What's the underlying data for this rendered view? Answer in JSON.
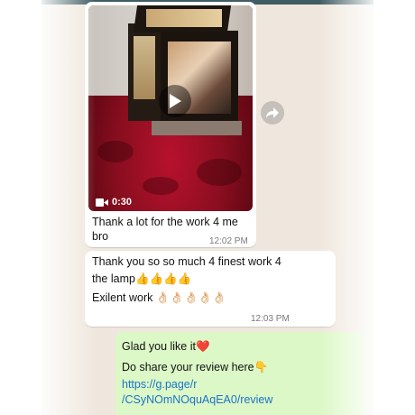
{
  "messages": [
    {
      "direction": "incoming",
      "media": {
        "type": "video",
        "duration": "0:30"
      },
      "text_lines": [
        "Thank a lot for the work 4 me",
        "bro"
      ],
      "time": "12:02 PM"
    },
    {
      "direction": "incoming",
      "text_lines": [
        "Thank you so so much 4 finest work 4",
        "the lamp👍👍👍👍",
        "Exilent work 👌🏻👌🏻👌🏻👌🏻👌🏻"
      ],
      "time": "12:03 PM"
    },
    {
      "direction": "outgoing",
      "text_lines": [
        "Glad you like it❤️",
        "Do share your review here👇"
      ],
      "link_lines": [
        "https://g.page/r",
        "/CSyNOmNOquAqEA0/review"
      ]
    }
  ],
  "icons": {
    "play": "play-icon",
    "video_camera": "video-camera-icon",
    "forward": "forward-icon"
  },
  "colors": {
    "chat_background": "#efe7dd",
    "incoming_bubble": "#ffffff",
    "outgoing_bubble": "#dcf8c6",
    "link": "#1a73c9",
    "header": "#3f5d63"
  }
}
